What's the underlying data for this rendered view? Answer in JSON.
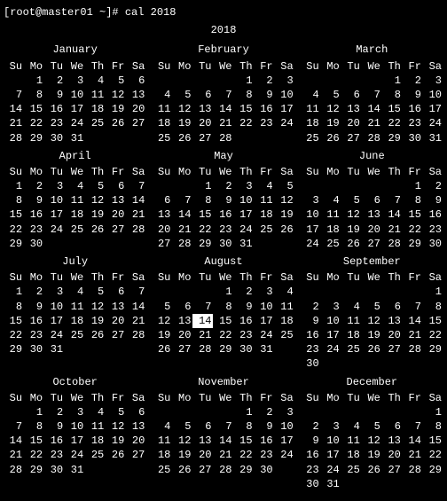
{
  "prompt": "[root@master01 ~]# cal 2018",
  "year_title": "2018",
  "day_headers": [
    "Su",
    "Mo",
    "Tu",
    "We",
    "Th",
    "Fr",
    "Sa"
  ],
  "today": {
    "month_index": 7,
    "day": 14
  },
  "months": [
    {
      "name": "January",
      "first_weekday": 1,
      "days": 31
    },
    {
      "name": "February",
      "first_weekday": 4,
      "days": 28
    },
    {
      "name": "March",
      "first_weekday": 4,
      "days": 31
    },
    {
      "name": "April",
      "first_weekday": 0,
      "days": 30
    },
    {
      "name": "May",
      "first_weekday": 2,
      "days": 31
    },
    {
      "name": "June",
      "first_weekday": 5,
      "days": 30
    },
    {
      "name": "July",
      "first_weekday": 0,
      "days": 31
    },
    {
      "name": "August",
      "first_weekday": 3,
      "days": 31
    },
    {
      "name": "September",
      "first_weekday": 6,
      "days": 30
    },
    {
      "name": "October",
      "first_weekday": 1,
      "days": 31
    },
    {
      "name": "November",
      "first_weekday": 4,
      "days": 30
    },
    {
      "name": "December",
      "first_weekday": 6,
      "days": 31
    }
  ]
}
